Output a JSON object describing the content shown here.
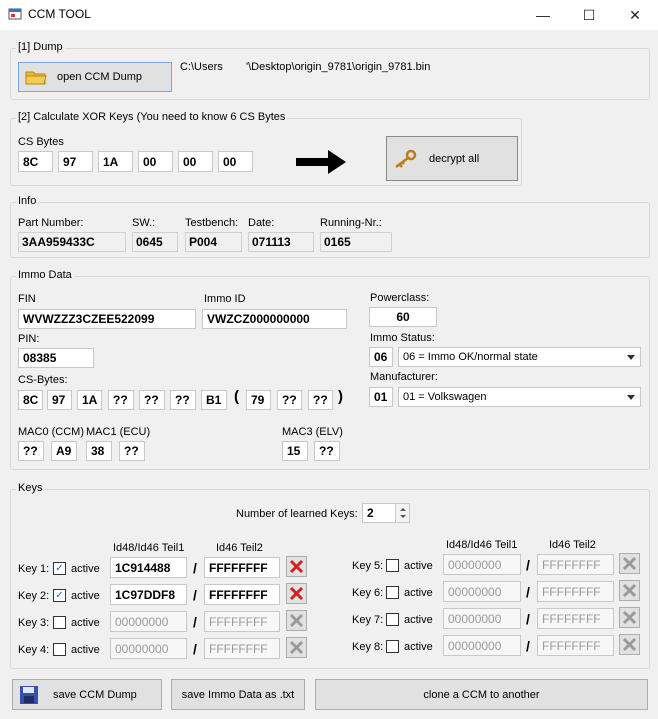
{
  "window": {
    "title": "CCM TOOL",
    "minimize": "—",
    "maximize": "☐",
    "close": "✕"
  },
  "dump": {
    "group_title": "[1] Dump",
    "open_button": "open CCM Dump",
    "path_prefix": "C:\\Users",
    "path_suffix": "'\\Desktop\\origin_9781\\origin_9781.bin"
  },
  "xor": {
    "group_title": "[2] Calculate XOR Keys (You need to know 6 CS Bytes",
    "cs_label": "CS Bytes",
    "cs_bytes": [
      "8C",
      "97",
      "1A",
      "00",
      "00",
      "00"
    ],
    "decrypt_button": "decrypt all"
  },
  "info": {
    "group_title": "Info",
    "part_number_label": "Part Number:",
    "part_number": "3AA959433C",
    "sw_label": "SW.:",
    "sw": "0645",
    "testbench_label": "Testbench:",
    "testbench": "P004",
    "date_label": "Date:",
    "date": "071113",
    "running_label": "Running-Nr.:",
    "running": "0165"
  },
  "immo": {
    "group_title": "Immo Data",
    "fin_label": "FIN",
    "fin": "WVWZZZ3CZEE522099",
    "immo_id_label": "Immo ID",
    "immo_id": "VWZCZ000000000",
    "pin_label": "PIN:",
    "pin": "08385",
    "cs_label": "CS-Bytes:",
    "cs_bytes": [
      "8C",
      "97",
      "1A",
      "??",
      "??",
      "??",
      "B1"
    ],
    "paren_open": "(",
    "paren_bytes": [
      "79",
      "??",
      "??"
    ],
    "paren_close": ")",
    "mac0_label": "MAC0 (CCM)",
    "mac0": "??",
    "mac1_label": "MAC1 (ECU)",
    "mac1": [
      "A9",
      "38",
      "??"
    ],
    "mac3_label": "MAC3 (ELV)",
    "mac3": [
      "15",
      "??"
    ],
    "powerclass_label": "Powerclass:",
    "powerclass": "60",
    "status_label": "Immo Status:",
    "status_code": "06",
    "status_value": "06 = Immo OK/normal state",
    "manufacturer_label": "Manufacturer:",
    "manufacturer_code": "01",
    "manufacturer_value": "01 = Volkswagen"
  },
  "keys": {
    "group_title": "Keys",
    "learned_label": "Number of learned Keys:",
    "learned_value": "2",
    "col1": "Id48/Id46 Teil1",
    "col2": "Id46 Teil2",
    "active_label": "active",
    "slash": "/",
    "left": [
      {
        "label": "Key 1:",
        "checked": "✓",
        "teil1": "1C914488",
        "teil2": "FFFFFFFF"
      },
      {
        "label": "Key 2:",
        "checked": "✓",
        "teil1": "1C97DDF8",
        "teil2": "FFFFFFFF"
      },
      {
        "label": "Key 3:",
        "checked": "",
        "teil1": "00000000",
        "teil2": "FFFFFFFF"
      },
      {
        "label": "Key 4:",
        "checked": "",
        "teil1": "00000000",
        "teil2": "FFFFFFFF"
      }
    ],
    "right": [
      {
        "label": "Key 5:",
        "checked": "",
        "teil1": "00000000",
        "teil2": "FFFFFFFF"
      },
      {
        "label": "Key 6:",
        "checked": "",
        "teil1": "00000000",
        "teil2": "FFFFFFFF"
      },
      {
        "label": "Key 7:",
        "checked": "",
        "teil1": "00000000",
        "teil2": "FFFFFFFF"
      },
      {
        "label": "Key 8:",
        "checked": "",
        "teil1": "00000000",
        "teil2": "FFFFFFFF"
      }
    ]
  },
  "bottom": {
    "save_dump": "save CCM Dump",
    "save_txt": "save Immo Data as .txt",
    "clone": "clone a CCM to another"
  },
  "colors": {
    "red_x": "#d42020",
    "gray_x": "#9a9a9a",
    "folder": "#e8b830",
    "save_icon": "#3a4fa8"
  }
}
